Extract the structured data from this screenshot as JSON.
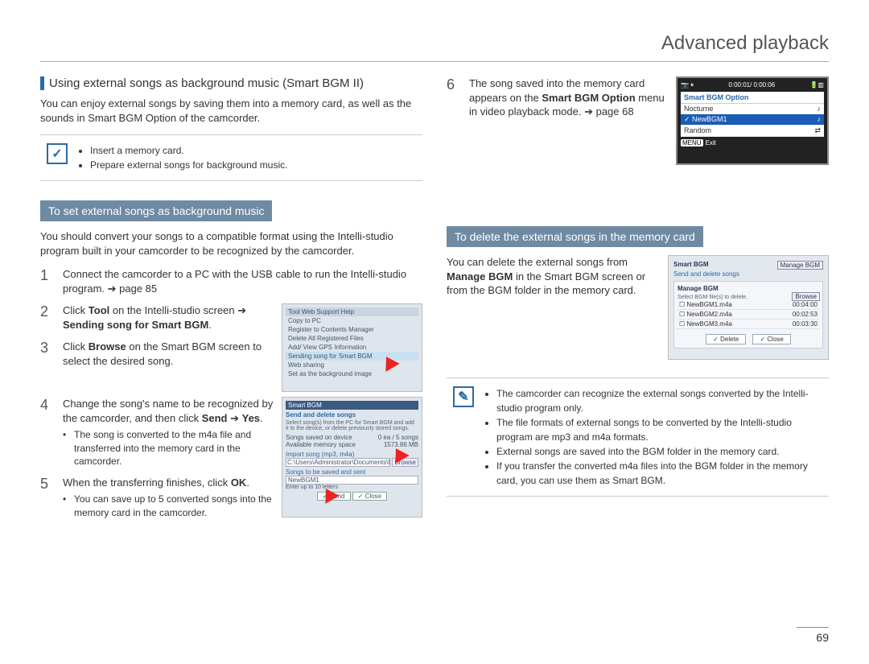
{
  "page": {
    "title": "Advanced playback",
    "page_number": "69"
  },
  "left": {
    "heading": "Using external songs as background music (Smart BGM II)",
    "intro": "You can enjoy external songs by saving them into a memory card, as well as the sounds in Smart BGM Option of the camcorder.",
    "prep_notes": [
      "Insert a memory card.",
      "Prepare external songs for background music."
    ],
    "subheader": "To set external songs as background music",
    "sub_intro": "You should convert your songs to a compatible format using the Intelli-studio program built in your camcorder to be recognized by the camcorder.",
    "steps": {
      "s1": "Connect the camcorder to a PC with the USB cable to run the Intelli-studio program. ➔ page 85",
      "s2_a": "Click ",
      "s2_b": "Tool",
      "s2_c": " on the Intelli-studio screen ➔ ",
      "s2_d": "Sending song for Smart BGM",
      "s2_e": ".",
      "s3_a": "Click ",
      "s3_b": "Browse",
      "s3_c": " on the Smart BGM screen to select the desired song.",
      "s4_a": "Change the song's name to be recognized by the camcorder, and then click ",
      "s4_b": "Send",
      "s4_c": " ➔ ",
      "s4_d": "Yes",
      "s4_e": ".",
      "s4_sub": "The song is converted to the m4a file and transferred into the memory card in the camcorder.",
      "s5_a": "When the transferring finishes, click ",
      "s5_b": "OK",
      "s5_c": ".",
      "s5_sub": "You can save up to 5 converted songs into the memory card in the camcorder."
    },
    "tool_menu": {
      "t": "Tool   Web Support   Help",
      "i1": "Copy to PC",
      "i2": "Register to Contents Manager",
      "i3": "Delete All Registered Files",
      "i4": "Add/ View GPS Information",
      "i5": "Sending song for Smart BGM",
      "i6": "Web sharing",
      "i7": "Set as the background image"
    },
    "bgm_dialog": {
      "t": "Smart BGM",
      "sub": "Send and delete songs",
      "hint": "Select song(s) from the PC for Smart BGM and add it to the device, or delete previously stored songs.",
      "r1a": "Songs saved on device",
      "r1b": "0 ea / 5 songs",
      "r2a": "Available memory space",
      "r2b": "1573.86 MB",
      "imp": "Import song (mp3, m4a)",
      "path": "C:\\Users\\Administrator\\Documents\\Music",
      "browse": "Browse",
      "sav": "Songs to be saved and sent",
      "name": "NewBGM1",
      "limit": "Enter up to 10 letters",
      "send": "Send",
      "close": "Close"
    }
  },
  "right": {
    "step6_a": "The song saved into the memory card appears on the ",
    "step6_b": "Smart BGM Option",
    "step6_c": " menu in video playback mode. ➔ page 68",
    "lcd": {
      "time": "0:00:01/ 0:00:06",
      "title": "Smart BGM Option",
      "r1": "Nocturne",
      "r2": "NewBGM1",
      "r3": "Random",
      "exit": "Exit",
      "menu": "MENU"
    },
    "subheader": "To delete the external songs in the memory card",
    "sub_text_a": "You can delete the external songs from ",
    "sub_text_b": "Manage BGM",
    "sub_text_c": " in the Smart BGM screen or from the BGM folder in the memory card.",
    "mgr": {
      "t1": "Smart BGM",
      "sub": "Send and delete songs",
      "t2": "Manage BGM",
      "hint": "Select BGM file(s) to delete.",
      "f1a": "NewBGM1.m4a",
      "f1b": "00:04:00",
      "f2a": "NewBGM2.m4a",
      "f2b": "00:02:53",
      "f3a": "NewBGM3.m4a",
      "f3b": "00:03:30",
      "del": "Delete",
      "close": "Close",
      "browse": "Browse",
      "mng": "Manage BGM"
    },
    "notes": [
      "The camcorder can recognize the external songs converted by the Intelli-studio program only.",
      "The file formats of external songs to be converted by the Intelli-studio program are mp3 and m4a formats.",
      "External songs are saved into the BGM folder in the memory card.",
      "If you transfer the converted m4a files into the BGM folder in the memory card, you can use them as Smart BGM."
    ]
  }
}
